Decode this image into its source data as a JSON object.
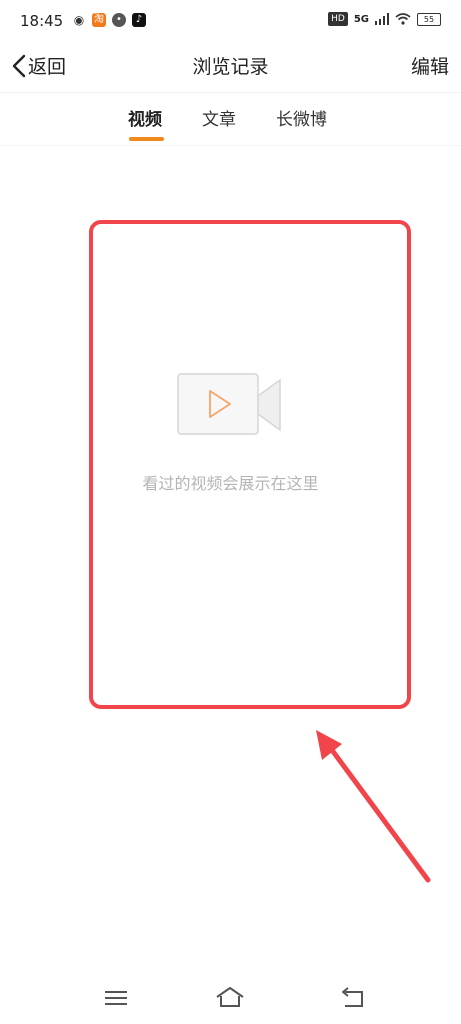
{
  "status_bar": {
    "time": "18:45",
    "app_icons": [
      "weibo-icon",
      "taobao-icon",
      "message-icon",
      "tiktok-icon"
    ],
    "hd_label": "HD",
    "network_label": "5G",
    "battery_level": "55"
  },
  "nav": {
    "back_label": "返回",
    "title": "浏览记录",
    "edit_label": "编辑"
  },
  "tabs": [
    {
      "label": "视频",
      "active": true
    },
    {
      "label": "文章",
      "active": false
    },
    {
      "label": "长微博",
      "active": false
    }
  ],
  "empty_state": {
    "message": "看过的视频会展示在这里",
    "icon": "video-camera-icon"
  },
  "annotation": {
    "box_color": "#f2444b",
    "arrow_color": "#f2444b"
  },
  "colors": {
    "accent": "#f08a1c",
    "annotation": "#f2444b",
    "empty_text": "#b5b5b5"
  },
  "bottom_nav": {
    "icons": [
      "menu-icon",
      "home-icon",
      "back-icon"
    ]
  }
}
